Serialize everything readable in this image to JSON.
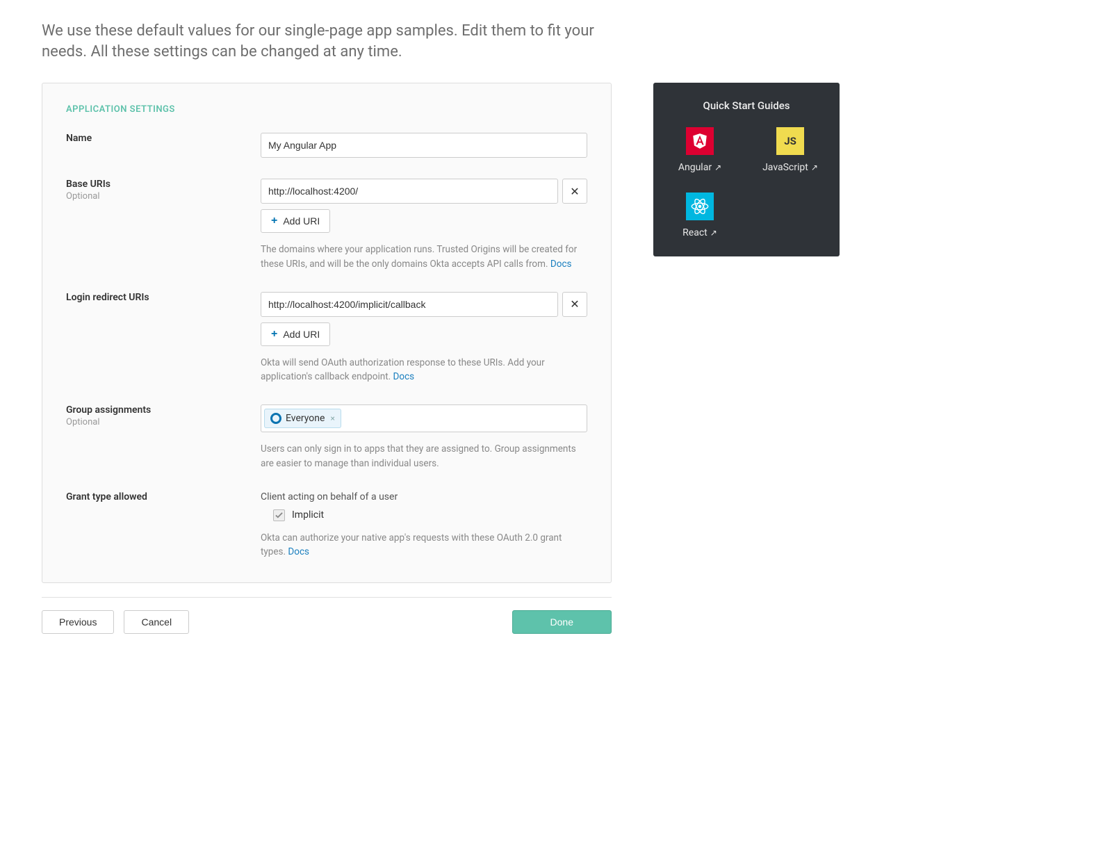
{
  "intro": "We use these default values for our single-page app samples. Edit them to fit your needs. All these settings can be changed at any time.",
  "section_title": "APPLICATION SETTINGS",
  "fields": {
    "name": {
      "label": "Name",
      "value": "My Angular App"
    },
    "base_uris": {
      "label": "Base URIs",
      "sublabel": "Optional",
      "items": [
        "http://localhost:4200/"
      ],
      "add_label": "Add URI",
      "help": "The domains where your application runs. Trusted Origins will be created for these URIs, and will be the only domains Okta accepts API calls from. ",
      "docs": "Docs"
    },
    "login_redirect": {
      "label": "Login redirect URIs",
      "items": [
        "http://localhost:4200/implicit/callback"
      ],
      "add_label": "Add URI",
      "help": "Okta will send OAuth authorization response to these URIs. Add your application's callback endpoint. ",
      "docs": "Docs"
    },
    "group_assignments": {
      "label": "Group assignments",
      "sublabel": "Optional",
      "chips": [
        "Everyone"
      ],
      "help": "Users can only sign in to apps that they are assigned to. Group assignments are easier to manage than individual users."
    },
    "grant_type": {
      "label": "Grant type allowed",
      "heading": "Client acting on behalf of a user",
      "options": [
        {
          "label": "Implicit",
          "checked": true,
          "disabled": true
        }
      ],
      "help": "Okta can authorize your native app's requests with these OAuth 2.0 grant types. ",
      "docs": "Docs"
    }
  },
  "footer": {
    "previous": "Previous",
    "cancel": "Cancel",
    "done": "Done"
  },
  "sidebar": {
    "title": "Quick Start Guides",
    "guides": [
      {
        "name": "Angular",
        "color": "#dd0031",
        "glyph": "A"
      },
      {
        "name": "JavaScript",
        "color": "#f0db4f",
        "glyph": "JS"
      },
      {
        "name": "React",
        "color": "#00b7e0",
        "glyph": "react"
      }
    ]
  }
}
